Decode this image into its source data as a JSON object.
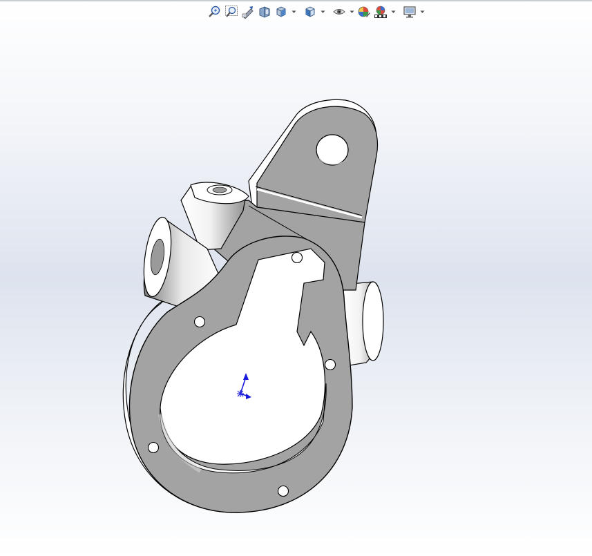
{
  "viewport": {
    "background_top": "#ffffff",
    "background_mid": "#dde3ee",
    "accent_axis": "#1a1adc"
  },
  "toolbar": {
    "buttons": [
      {
        "name": "zoom-to-fit-icon",
        "dropdown": false
      },
      {
        "name": "zoom-to-area-icon",
        "dropdown": false
      },
      {
        "name": "previous-view-icon",
        "dropdown": false
      },
      {
        "name": "section-view-icon",
        "dropdown": false
      },
      {
        "name": "view-orientation-icon",
        "dropdown": true
      },
      {
        "name": "display-style-icon",
        "dropdown": true
      },
      {
        "name": "hide-show-items-icon",
        "dropdown": true
      },
      {
        "name": "edit-appearance-icon",
        "dropdown": false
      },
      {
        "name": "apply-scene-icon",
        "dropdown": true
      },
      {
        "name": "view-settings-icon",
        "dropdown": true
      }
    ]
  },
  "model": {
    "part_color": "#a3a3a3",
    "edge_color": "#000000",
    "fillet_shade": "#ffffff"
  }
}
